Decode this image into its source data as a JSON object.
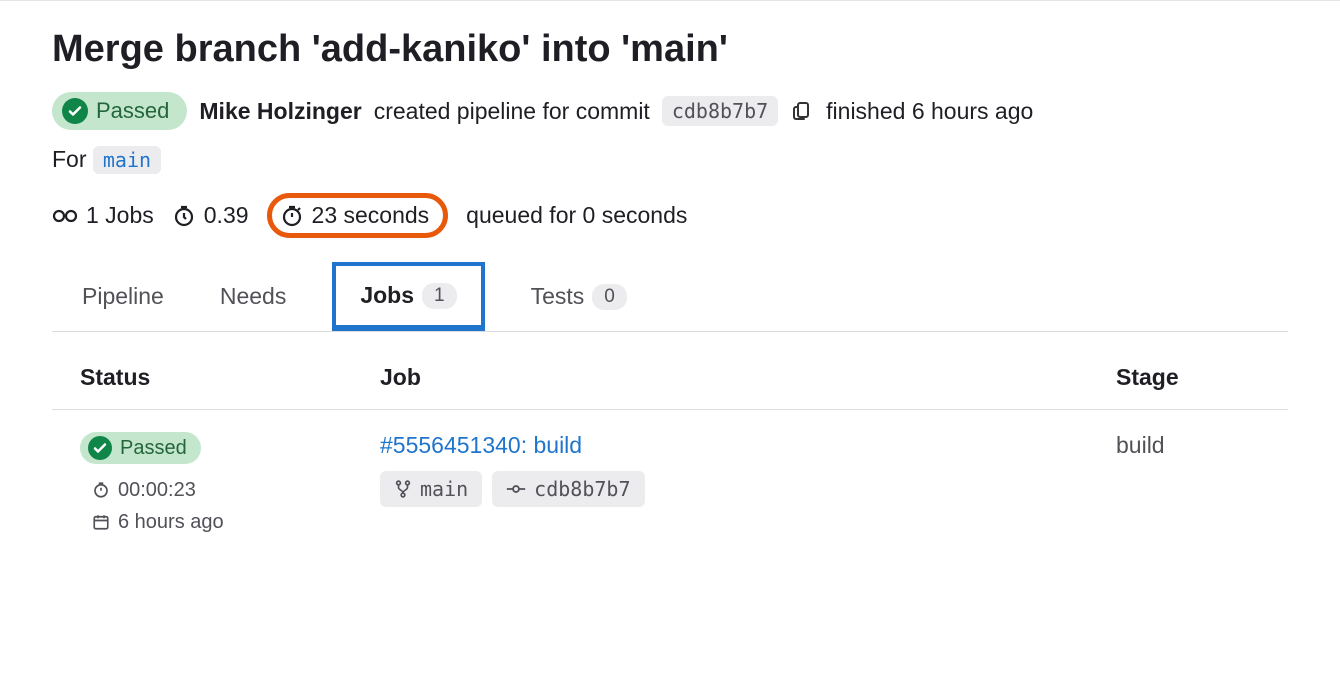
{
  "title": "Merge branch 'add-kaniko' into 'main'",
  "status": {
    "label": "Passed"
  },
  "author": "Mike Holzinger",
  "created_text": "created pipeline for commit",
  "commit_sha": "cdb8b7b7",
  "finished_text": "finished 6 hours ago",
  "for_label": "For",
  "ref": "main",
  "stats": {
    "jobs_count": "1 Jobs",
    "score": "0.39",
    "duration": "23 seconds",
    "queued": "queued for 0 seconds"
  },
  "tabs": {
    "pipeline": "Pipeline",
    "needs": "Needs",
    "jobs": "Jobs",
    "jobs_count": "1",
    "tests": "Tests",
    "tests_count": "0"
  },
  "table": {
    "headers": {
      "status": "Status",
      "job": "Job",
      "stage": "Stage"
    },
    "rows": [
      {
        "status": "Passed",
        "duration": "00:00:23",
        "when": "6 hours ago",
        "job_link": "#5556451340: build",
        "job_ref": "main",
        "job_sha": "cdb8b7b7",
        "stage": "build"
      }
    ]
  }
}
